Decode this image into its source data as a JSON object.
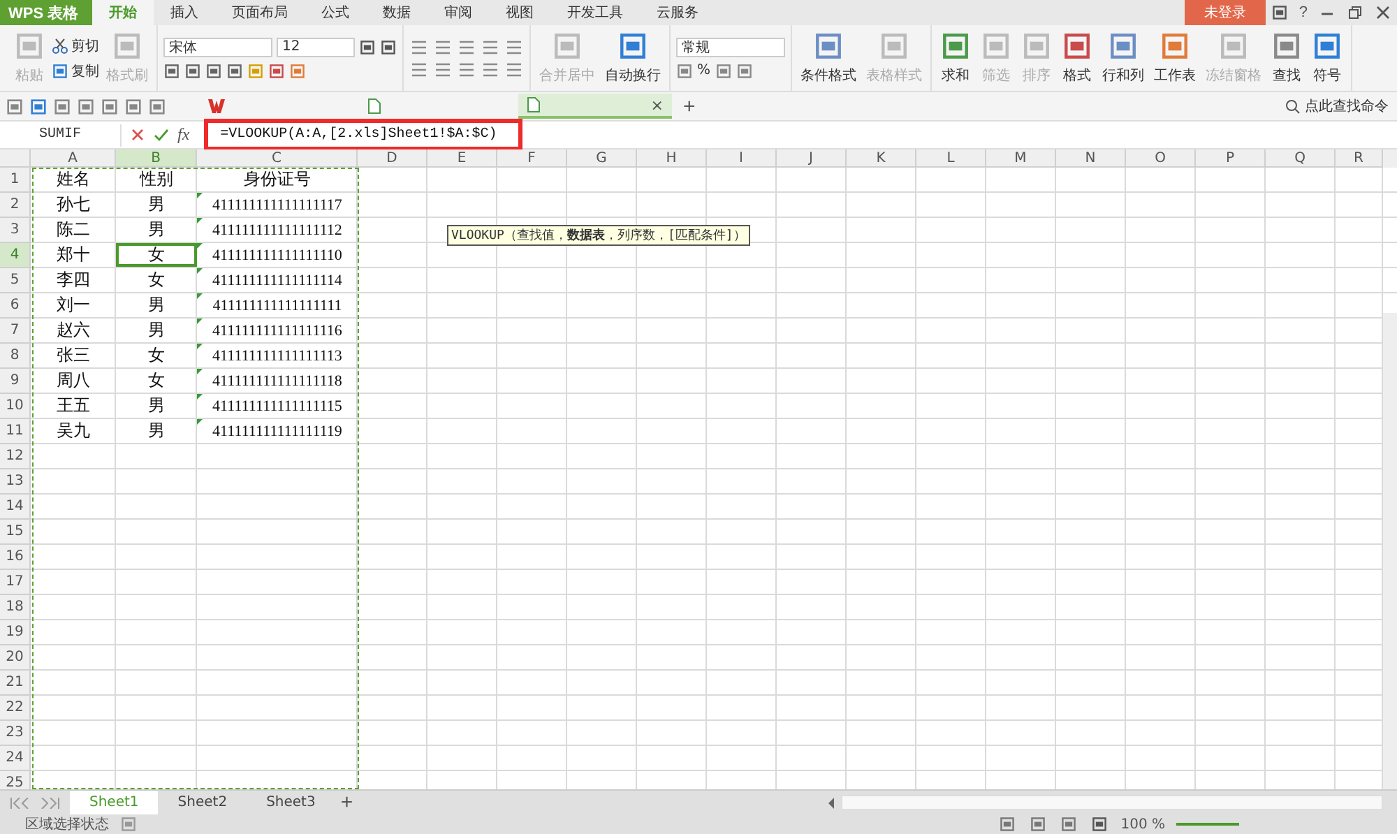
{
  "app_button": {
    "label": "WPS 表格"
  },
  "ribbon_tabs": [
    {
      "label": "开始",
      "selected": true
    },
    {
      "label": "插入",
      "selected": false
    },
    {
      "label": "页面布局",
      "selected": false
    },
    {
      "label": "公式",
      "selected": false
    },
    {
      "label": "数据",
      "selected": false
    },
    {
      "label": "审阅",
      "selected": false
    },
    {
      "label": "视图",
      "selected": false
    },
    {
      "label": "开发工具",
      "selected": false
    },
    {
      "label": "云服务",
      "selected": false
    }
  ],
  "login_button": "未登录",
  "help_button": "?",
  "ribbon": {
    "paste": {
      "label": "粘贴",
      "disabled": true
    },
    "cut": {
      "label": "剪切",
      "disabled": false
    },
    "copy": {
      "label": "复制",
      "disabled": false
    },
    "format_painter": {
      "label": "格式刷",
      "disabled": true
    },
    "font_name": "宋体",
    "font_size": "12",
    "merge_center": {
      "label": "合并居中",
      "disabled": true
    },
    "wrap_text": {
      "label": "自动换行",
      "disabled": false
    },
    "number_format": "常规",
    "percent": "%",
    "large_buttons": [
      {
        "label": "条件格式",
        "disabled": false
      },
      {
        "label": "表格样式",
        "disabled": true
      },
      {
        "label": "求和",
        "disabled": false
      },
      {
        "label": "筛选",
        "disabled": true
      },
      {
        "label": "排序",
        "disabled": true
      },
      {
        "label": "格式",
        "disabled": false
      },
      {
        "label": "行和列",
        "disabled": false
      },
      {
        "label": "工作表",
        "disabled": false
      },
      {
        "label": "冻结窗格",
        "disabled": true
      },
      {
        "label": "查找",
        "disabled": false
      },
      {
        "label": "符号",
        "disabled": false
      }
    ]
  },
  "document_tabs": [
    {
      "selected": false
    },
    {
      "selected": false
    },
    {
      "selected": true,
      "close": "×"
    }
  ],
  "new_tab": "+",
  "command_search": {
    "placeholder": "点此查找命令"
  },
  "formula_bar": {
    "name_box": "SUMIF",
    "fx": "fx",
    "formula": "=VLOOKUP(A:A,[2.xls]Sheet1!$A:$C)"
  },
  "columns": [
    {
      "label": "A",
      "selected": false
    },
    {
      "label": "B",
      "selected": true
    },
    {
      "label": "C",
      "selected": false
    },
    {
      "label": "D",
      "selected": false
    },
    {
      "label": "E",
      "selected": false
    },
    {
      "label": "F",
      "selected": false
    },
    {
      "label": "G",
      "selected": false
    },
    {
      "label": "H",
      "selected": false
    },
    {
      "label": "I",
      "selected": false
    },
    {
      "label": "J",
      "selected": false
    },
    {
      "label": "K",
      "selected": false
    },
    {
      "label": "L",
      "selected": false
    },
    {
      "label": "M",
      "selected": false
    },
    {
      "label": "N",
      "selected": false
    },
    {
      "label": "O",
      "selected": false
    },
    {
      "label": "P",
      "selected": false
    },
    {
      "label": "Q",
      "selected": false
    },
    {
      "label": "R",
      "selected": false
    }
  ],
  "rows": [
    {
      "number": "1",
      "selected": false,
      "cells": [
        "姓名",
        "性别",
        "身份证号"
      ],
      "flagged": false
    },
    {
      "number": "2",
      "selected": false,
      "cells": [
        "孙七",
        "男",
        "411111111111111117"
      ],
      "flagged": true
    },
    {
      "number": "3",
      "selected": false,
      "cells": [
        "陈二",
        "男",
        "411111111111111112"
      ],
      "flagged": true
    },
    {
      "number": "4",
      "selected": true,
      "cells": [
        "郑十",
        "女",
        "411111111111111110"
      ],
      "flagged": true
    },
    {
      "number": "5",
      "selected": false,
      "cells": [
        "李四",
        "女",
        "411111111111111114"
      ],
      "flagged": true
    },
    {
      "number": "6",
      "selected": false,
      "cells": [
        "刘一",
        "男",
        "411111111111111111"
      ],
      "flagged": true
    },
    {
      "number": "7",
      "selected": false,
      "cells": [
        "赵六",
        "男",
        "411111111111111116"
      ],
      "flagged": true
    },
    {
      "number": "8",
      "selected": false,
      "cells": [
        "张三",
        "女",
        "411111111111111113"
      ],
      "flagged": true
    },
    {
      "number": "9",
      "selected": false,
      "cells": [
        "周八",
        "女",
        "411111111111111118"
      ],
      "flagged": true
    },
    {
      "number": "10",
      "selected": false,
      "cells": [
        "王五",
        "男",
        "411111111111111115"
      ],
      "flagged": true
    },
    {
      "number": "11",
      "selected": false,
      "cells": [
        "吴九",
        "男",
        "411111111111111119"
      ],
      "flagged": true
    },
    {
      "number": "12",
      "selected": false
    },
    {
      "number": "13",
      "selected": false
    },
    {
      "number": "14",
      "selected": false
    },
    {
      "number": "15",
      "selected": false
    },
    {
      "number": "16",
      "selected": false
    },
    {
      "number": "17",
      "selected": false
    },
    {
      "number": "18",
      "selected": false
    },
    {
      "number": "19",
      "selected": false
    },
    {
      "number": "20",
      "selected": false
    },
    {
      "number": "21",
      "selected": false
    },
    {
      "number": "22",
      "selected": false
    },
    {
      "number": "23",
      "selected": false
    },
    {
      "number": "24",
      "selected": false
    },
    {
      "number": "25",
      "selected": false
    }
  ],
  "tooltip": "VLOOKUP（查找值，**数据表**，列序数，[匹配条件]）",
  "sheet_tabs": [
    {
      "label": "Sheet1",
      "selected": true
    },
    {
      "label": "Sheet2",
      "selected": false
    },
    {
      "label": "Sheet3",
      "selected": false
    }
  ],
  "add_sheet": "+",
  "status_bar": {
    "mode": "区域选择状态",
    "zoom": "100 %",
    "zoom_slider": {
      "level": 0.5
    }
  }
}
